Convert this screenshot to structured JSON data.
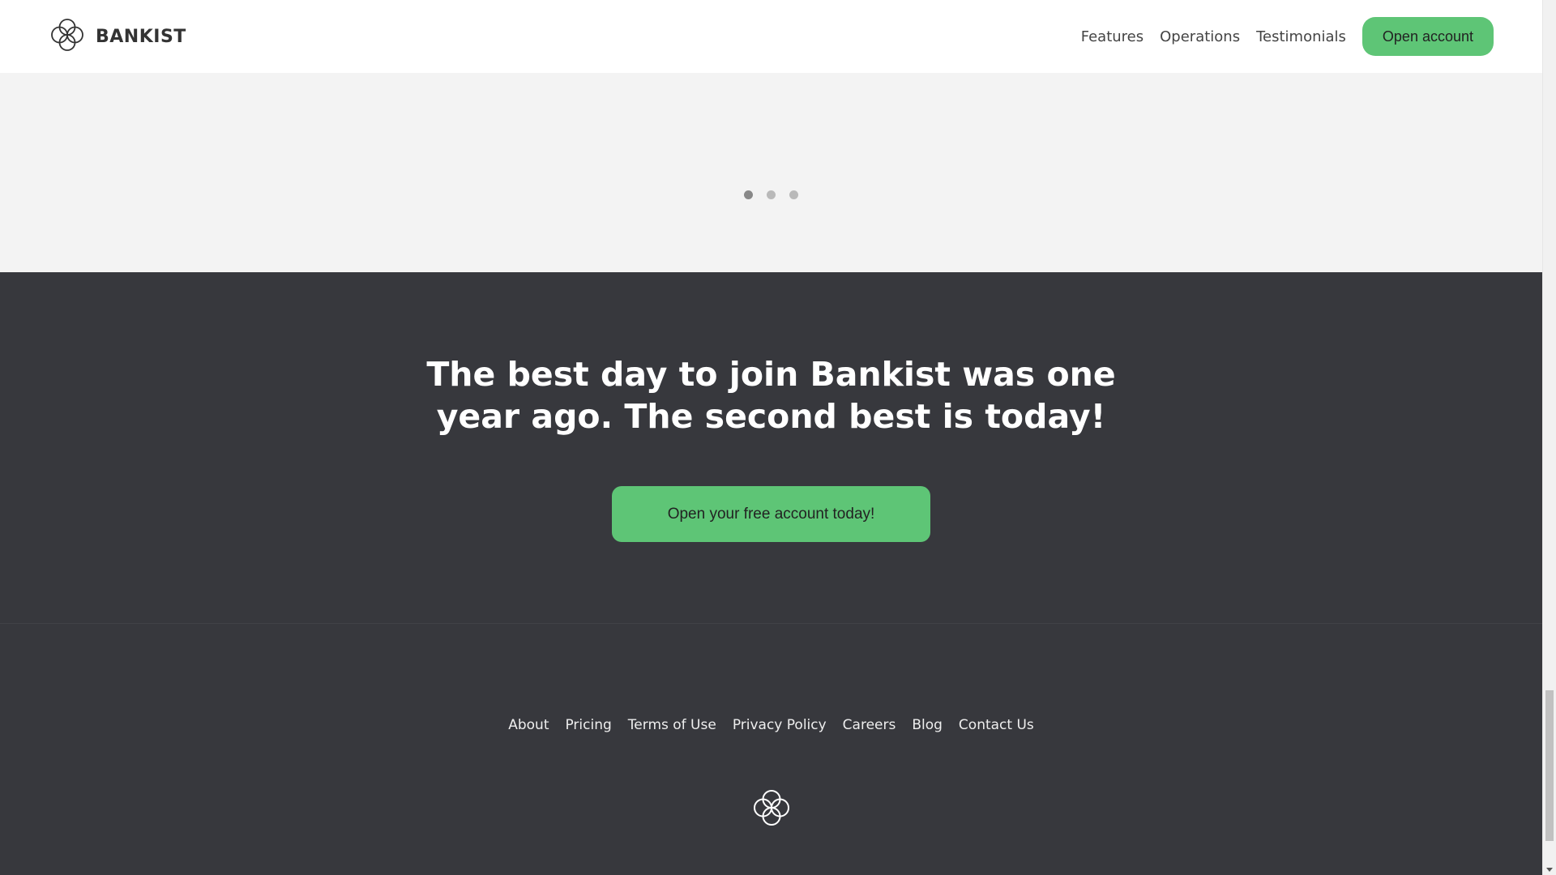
{
  "nav": {
    "brand_name": "BANKIST",
    "links": [
      "Features",
      "Operations",
      "Testimonials"
    ],
    "cta_label": "Open account"
  },
  "slider": {
    "dots": 3,
    "active_index": 0
  },
  "signup": {
    "heading_line1": "The best day to join Bankist was one",
    "heading_line2": "year ago. The second best is today!",
    "button_label": "Open your free account today!"
  },
  "footer": {
    "links": [
      "About",
      "Pricing",
      "Terms of Use",
      "Privacy Policy",
      "Careers",
      "Blog",
      "Contact Us"
    ]
  },
  "icons": {
    "brand_logo": "bankist-logo-icon",
    "footer_logo": "bankist-logo-icon"
  },
  "colors": {
    "accent": "#5ec576",
    "dark_bg": "#37383d",
    "light_bg": "#f3f3f3"
  }
}
